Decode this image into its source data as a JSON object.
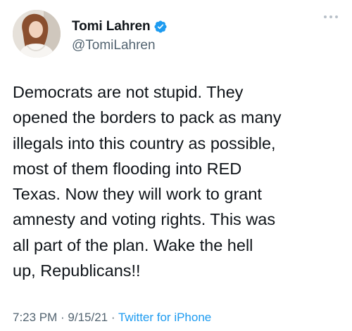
{
  "author": {
    "display_name": "Tomi Lahren",
    "handle": "@TomiLahren"
  },
  "tweet": {
    "lines": [
      "Democrats are not stupid. They",
      "opened the borders to pack as many",
      "illegals into this country as possible,",
      "most of them flooding into RED",
      "Texas. Now they will work to grant",
      "amnesty and voting rights. This was",
      "all part of the plan. Wake the hell",
      "up, Republicans!!"
    ]
  },
  "meta": {
    "time": "7:23 PM",
    "separator": " · ",
    "date": "9/15/21",
    "source": "Twitter for iPhone"
  },
  "colors": {
    "accent": "#1d9bf0",
    "secondary_text": "#536471",
    "primary_text": "#0f1419"
  },
  "icons": {
    "verified": "verified-badge-icon",
    "more": "more-options-icon"
  }
}
